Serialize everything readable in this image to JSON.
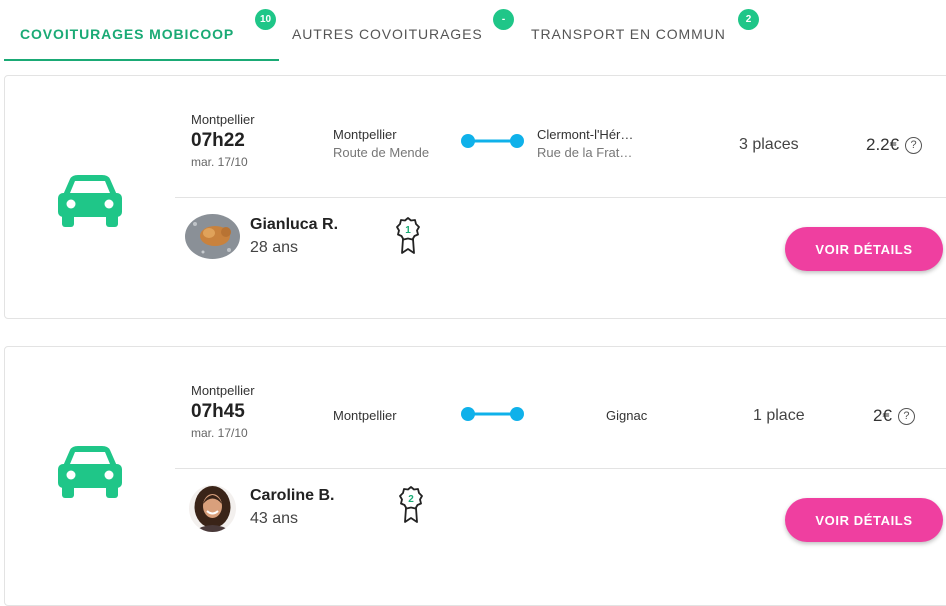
{
  "tabs": [
    {
      "label": "COVOITURAGES MOBICOOP",
      "count": "10",
      "active": true
    },
    {
      "label": "AUTRES COVOITURAGES",
      "count": "-",
      "active": false
    },
    {
      "label": "TRANSPORT EN COMMUN",
      "count": "2",
      "active": false
    }
  ],
  "colors": {
    "accent": "#1aaa75",
    "badge": "#1fc688",
    "route": "#0fb1ea",
    "button": "#ef3fa0"
  },
  "results": [
    {
      "departure_city": "Montpellier",
      "time": "07h22",
      "date": "mar. 17/10",
      "origin": "Montpellier",
      "origin_detail": "Route de Mende",
      "destination": "Clermont-l'Hér…",
      "destination_detail": "Rue de la Frat…",
      "places": "3 places",
      "price": "2.2€",
      "driver_name": "Gianluca R.",
      "driver_age": "28 ans",
      "badge_level": "1",
      "details_label": "VOIR DÉTAILS",
      "vehicle_icon": "car-icon",
      "help_icon": "question-icon"
    },
    {
      "departure_city": "Montpellier",
      "time": "07h45",
      "date": "mar. 17/10",
      "origin": "Montpellier",
      "origin_detail": "",
      "destination": "Gignac",
      "destination_detail": "",
      "places": "1 place",
      "price": "2€",
      "driver_name": "Caroline B.",
      "driver_age": "43 ans",
      "badge_level": "2",
      "details_label": "VOIR DÉTAILS",
      "vehicle_icon": "car-icon",
      "help_icon": "question-icon"
    }
  ]
}
